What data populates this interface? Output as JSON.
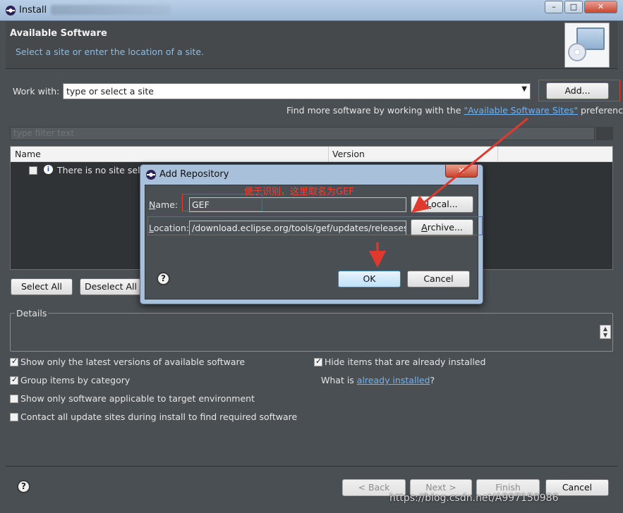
{
  "window": {
    "title": "Install",
    "controls": {
      "minimize": "–",
      "maximize": "□",
      "close": "✕"
    }
  },
  "header": {
    "title": "Available Software",
    "description": "Select a site or enter the location of a site."
  },
  "work_with": {
    "label": "Work with:",
    "placeholder": "type or select a site",
    "add_label": "Add..."
  },
  "find_more": {
    "prefix": "Find more software by working with the ",
    "link": "\"Available Software Sites\"",
    "suffix": " preferences."
  },
  "filter": {
    "placeholder": "type filter text"
  },
  "table": {
    "columns": [
      "Name",
      "Version"
    ],
    "rows": [
      {
        "text": "There is no site sele",
        "icon": "info-icon"
      }
    ]
  },
  "selection_buttons": {
    "select_all": "Select All",
    "deselect_all": "Deselect All"
  },
  "details": {
    "label": "Details"
  },
  "options": [
    {
      "label": "Show only the latest versions of available software",
      "checked": true
    },
    {
      "label": "Group items by category",
      "checked": true
    },
    {
      "label": "Show only software applicable to target environment",
      "checked": false
    },
    {
      "label": "Contact all update sites during install to find required software",
      "checked": false
    },
    {
      "label": "Hide items that are already installed",
      "checked": true
    }
  ],
  "what_is": {
    "prefix": "What is ",
    "link": "already installed",
    "suffix": "?"
  },
  "footer": {
    "back": "< Back",
    "next": "Next >",
    "finish": "Finish",
    "cancel": "Cancel"
  },
  "watermark": "https://blog.csdn.net/A997150986",
  "dialog": {
    "title": "Add Repository",
    "annotation": "便于识别，这里取名为GEF",
    "name_label_u": "N",
    "name_label_rest": "ame:",
    "name_value": "GEF",
    "local_u": "L",
    "local_rest": "ocal...",
    "location_label_u": "L",
    "location_label_rest": "ocation:",
    "location_value": "/download.eclipse.org/tools/gef/updates/releases/",
    "archive_u": "A",
    "archive_rest": "rchive...",
    "ok": "OK",
    "cancel": "Cancel"
  },
  "colors": {
    "annotation": "#e03a2e",
    "link": "#6fb3f0",
    "background": "#4a4f53"
  }
}
